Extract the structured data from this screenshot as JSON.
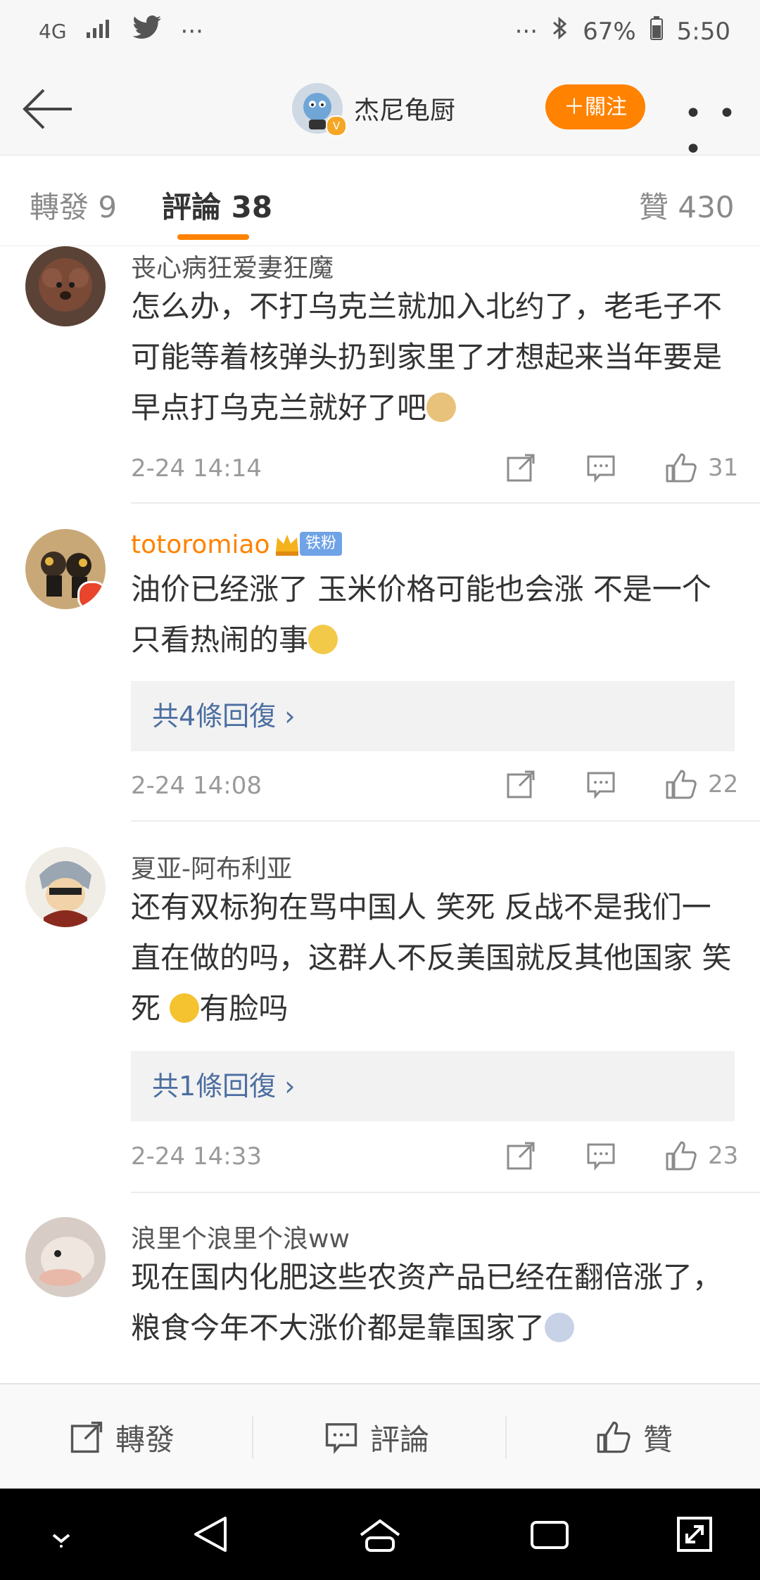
{
  "status_bar": {
    "network": "4G",
    "left_more": "···",
    "right_more": "···",
    "battery": "67%",
    "time": "5:50"
  },
  "header": {
    "title": "杰尼龟厨",
    "follow_label": "＋關注",
    "more": "• • •"
  },
  "tabs": [
    {
      "label": "轉發 9"
    },
    {
      "label": "評論 38"
    },
    {
      "label": "贊 430"
    }
  ],
  "comments": [
    {
      "user": "丧心病狂爱妻狂魔",
      "text": "怎么办，不打乌克兰就加入北约了，老毛子不可能等着核弹头扔到家里了才想起来当年要是早点打乌克兰就好了吧",
      "time": "2-24 14:14",
      "likes": "31"
    },
    {
      "user": "totoromiao",
      "badge": "铁粉",
      "text": "油价已经涨了 玉米价格可能也会涨 不是一个只看热闹的事",
      "replies": "共4條回復 ›",
      "time": "2-24 14:08",
      "likes": "22"
    },
    {
      "user": "夏亚-阿布利亚",
      "text_a": "还有双标狗在骂中国人 笑死 反战不是我们一直在做的吗，这群人不反美国就反其他国家 笑死 ",
      "text_b": "有脸吗",
      "replies": "共1條回復 ›",
      "time": "2-24 14:33",
      "likes": "23"
    },
    {
      "user": "浪里个浪里个浪ww",
      "text": "现在国内化肥这些农资产品已经在翻倍涨了，粮食今年不大涨价都是靠国家了"
    }
  ],
  "bottom_bar": {
    "repost": "轉發",
    "comment": "評論",
    "like": "贊"
  },
  "colors": {
    "accent": "#ff8200",
    "link": "#4c6ea0"
  }
}
